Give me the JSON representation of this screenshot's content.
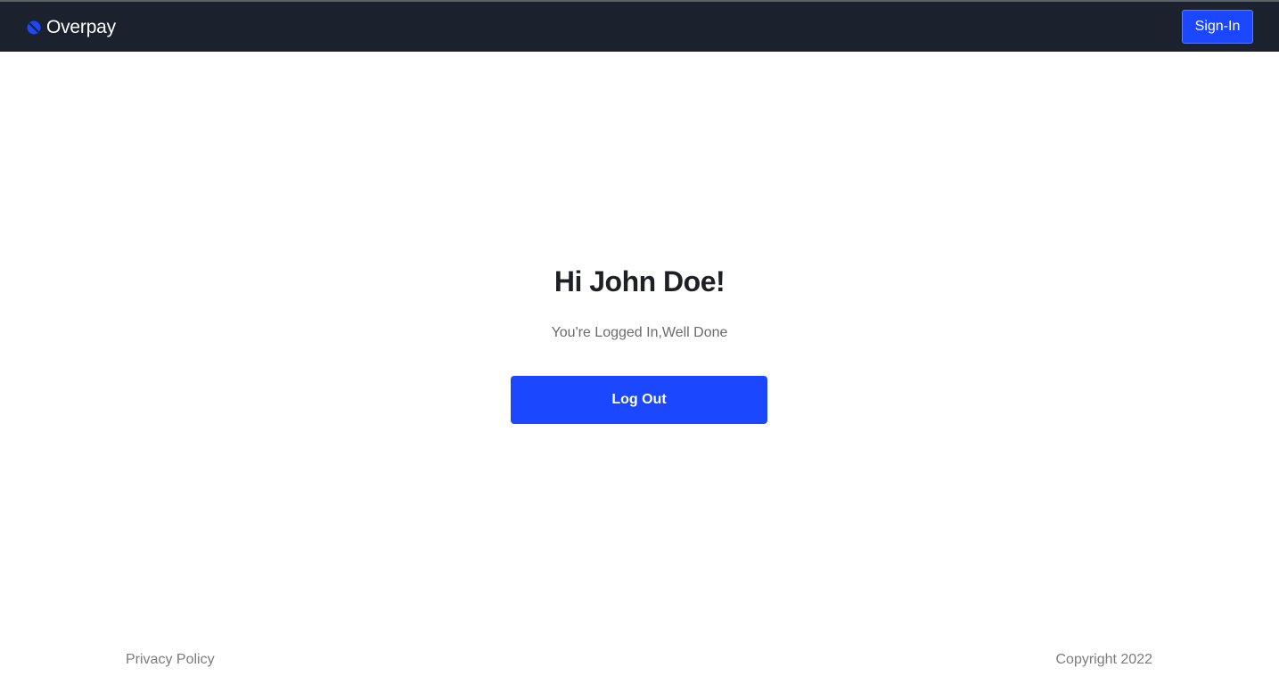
{
  "header": {
    "brand_name": "Overpay",
    "logo_icon": "overpay-logo-icon",
    "signin_label": "Sign-In"
  },
  "main": {
    "greeting": "Hi John Doe!",
    "status_message": "You're Logged In,Well Done",
    "logout_label": "Log Out"
  },
  "footer": {
    "privacy_label": "Privacy Policy",
    "copyright": "Copyright 2022"
  },
  "colors": {
    "navbar_bg": "#1b212d",
    "accent": "#1a47ff",
    "heading": "#1e2026",
    "muted_text": "#7c7c7c"
  }
}
